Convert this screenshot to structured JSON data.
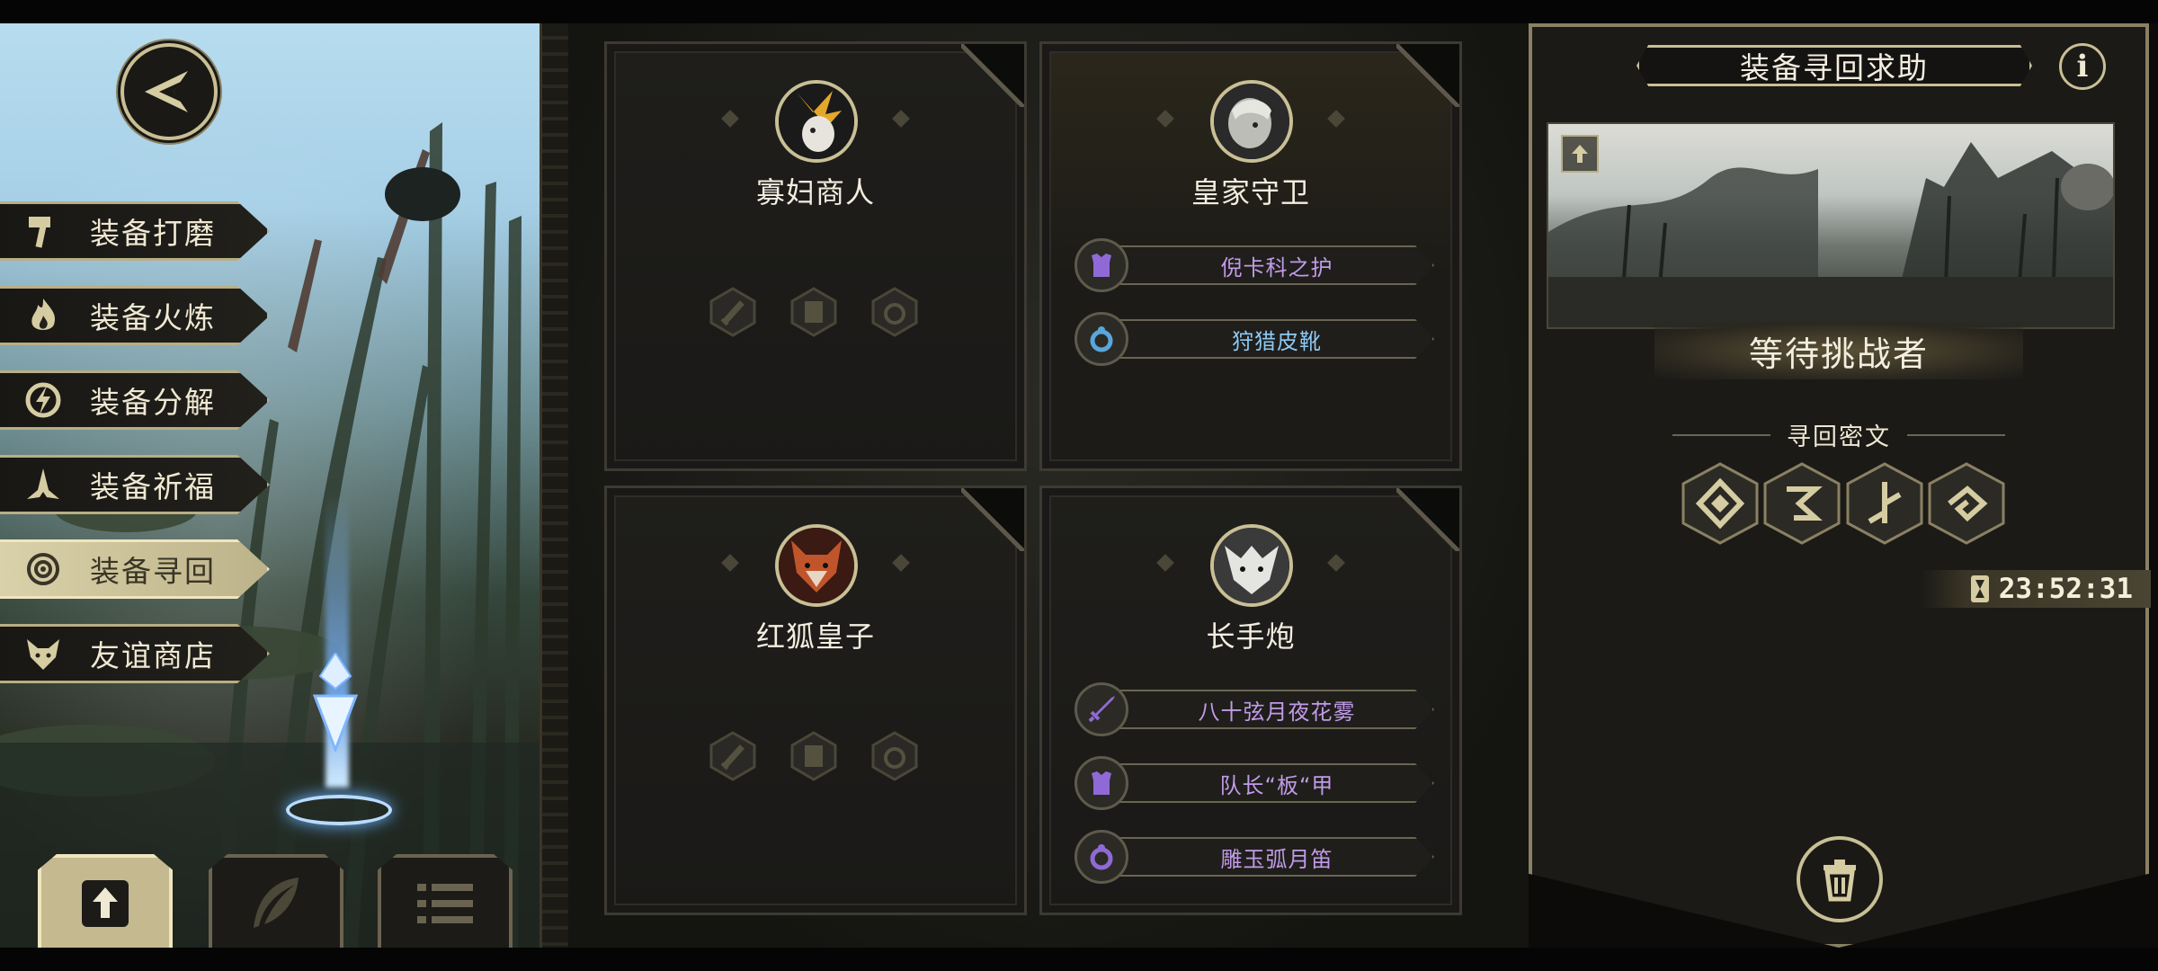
{
  "menu": {
    "items": [
      {
        "label": "装备打磨",
        "icon": "hammer-icon"
      },
      {
        "label": "装备火炼",
        "icon": "flame-icon"
      },
      {
        "label": "装备分解",
        "icon": "shatter-icon"
      },
      {
        "label": "装备祈福",
        "icon": "praying-hands-icon"
      },
      {
        "label": "装备寻回",
        "icon": "target-icon",
        "active": true
      },
      {
        "label": "友谊商店",
        "icon": "fox-icon"
      }
    ]
  },
  "cards": [
    {
      "name": "寡妇商人",
      "items": []
    },
    {
      "name": "皇家守卫",
      "items": [
        {
          "label": "倪卡科之护",
          "type": "armor-icon",
          "color": "purple"
        },
        {
          "label": "狩猎皮靴",
          "type": "ring-icon",
          "color": "blue"
        }
      ]
    },
    {
      "name": "红狐皇子",
      "items": []
    },
    {
      "name": "长手炮",
      "items": [
        {
          "label": "八十弦月夜花雾",
          "type": "sword-icon",
          "color": "purple"
        },
        {
          "label": "队长“板“甲",
          "type": "armor-icon",
          "color": "purple"
        },
        {
          "label": "雕玉弧月笛",
          "type": "ring-icon",
          "color": "purple"
        }
      ]
    }
  ],
  "panel": {
    "title": "装备寻回求助",
    "info_label": "i",
    "status": "等待挑战者",
    "cipher_title": "寻回密文",
    "timer": "23:52:31"
  },
  "colors": {
    "gold": "#c9bf95",
    "purple_text": "#c19be8",
    "blue_text": "#8ec9f2"
  }
}
